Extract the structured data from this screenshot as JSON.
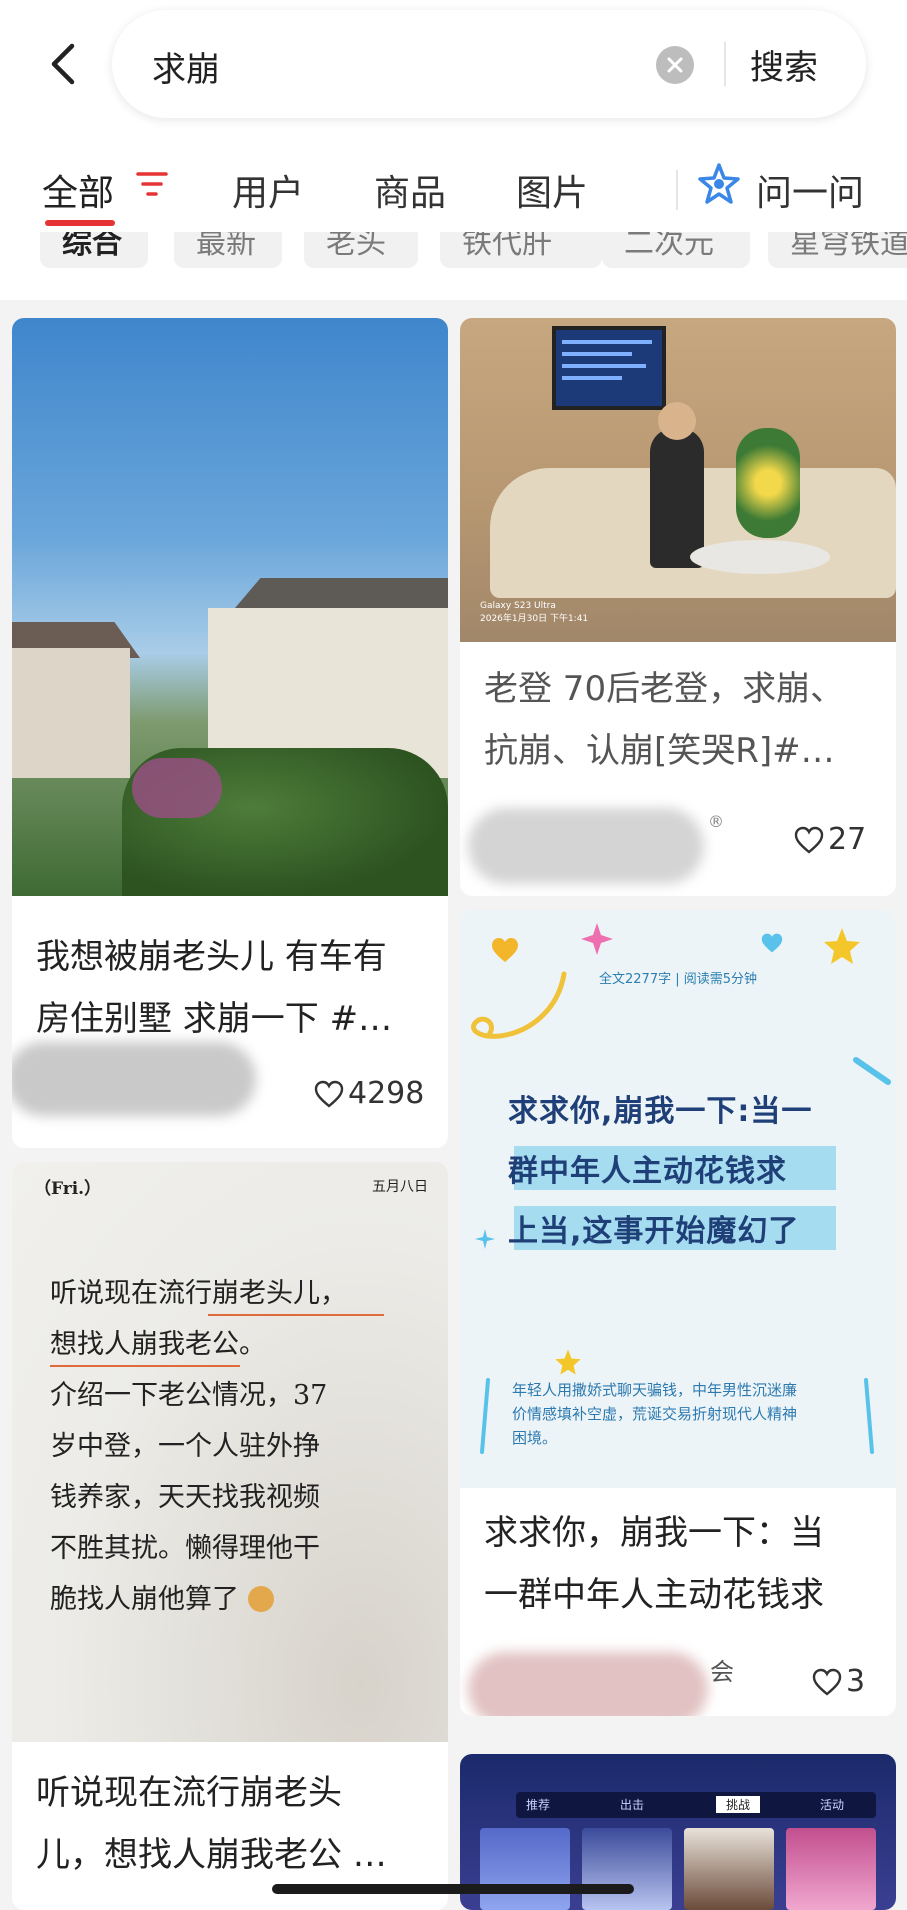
{
  "search": {
    "query": "求崩",
    "button_label": "搜索"
  },
  "tabs": {
    "all": "全部",
    "users": "用户",
    "goods": "商品",
    "images": "图片",
    "ask": "问一问"
  },
  "chips": [
    "综合",
    "最新",
    "老头",
    "铁代肝",
    "二次元",
    "星穹铁道"
  ],
  "colors": {
    "accent": "#e63336",
    "ask_icon": "#3a87e8",
    "card_bg": "#ffffff",
    "page_bg": "#f3f3f3"
  },
  "icons": [
    "back-arrow-icon",
    "clear-icon",
    "filter-icon",
    "ask-icon",
    "heart-icon"
  ],
  "feed": [
    {
      "title_lines": [
        "我想被崩老头儿 有车有",
        "房住别墅 求崩一下 #…"
      ],
      "likes": "4298"
    },
    {
      "camera_text": [
        "Galaxy S23 Ultra",
        "2026年1月30日 下午1:41"
      ],
      "title_lines": [
        "老登 70后老登，求崩、",
        "抗崩、认崩[笑哭R]#…"
      ],
      "likes": "27",
      "user_suffix": "®"
    },
    {
      "note_header": {
        "day": "（Fri.）",
        "date": "五月八日"
      },
      "note_lines": [
        "听说现在流行崩老头儿，",
        "想找人崩我老公。",
        "介绍一下老公情况，37",
        "岁中登，一个人驻外挣",
        "钱养家，天天找我视频",
        "不胜其扰。懒得理他干",
        "脆找人崩他算了"
      ],
      "title_lines": [
        "听说现在流行崩老头",
        "儿，想找人崩我老公 …"
      ]
    },
    {
      "article": {
        "sub": "全文2277字 | 阅读需5分钟",
        "lines": [
          "求求你,崩我一下:当一",
          "群中年人主动花钱求",
          "上当,这事开始魔幻了"
        ],
        "desc": [
          "年轻人用撒娇式聊天骗钱，中年男性沉迷廉",
          "价情感填补空虚，荒诞交易折射现代人精神",
          "困境。"
        ]
      },
      "title_lines": [
        "求求你，崩我一下：当",
        "一群中年人主动花钱求"
      ],
      "user_suffix": "会",
      "likes": "3"
    },
    {
      "game_tabs": [
        "推荐",
        "出击",
        "挑战",
        "活动"
      ]
    }
  ]
}
